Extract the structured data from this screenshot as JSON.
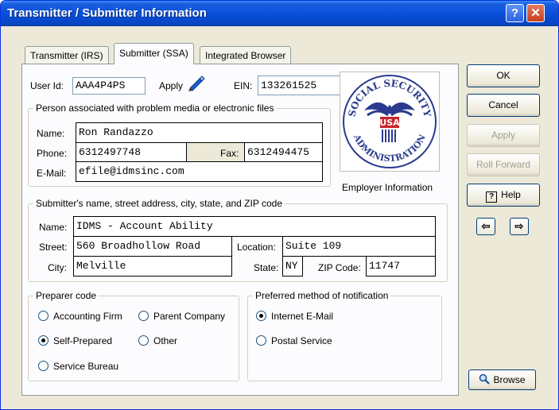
{
  "window": {
    "title": "Transmitter / Submitter Information",
    "help_glyph": "?",
    "close_glyph": "✕"
  },
  "tabs": [
    {
      "label": "Transmitter (IRS)"
    },
    {
      "label": "Submitter (SSA)"
    },
    {
      "label": "Integrated Browser"
    }
  ],
  "ids": {
    "user_id_label": "User Id:",
    "user_id_value": "AAA4P4PS",
    "apply_label": "Apply",
    "ein_label": "EIN:",
    "ein_value": "133261525"
  },
  "person_group": {
    "legend": "Person associated with problem media or electronic files",
    "name_label": "Name:",
    "name_value": "Ron Randazzo",
    "phone_label": "Phone:",
    "phone_value": "6312497748",
    "fax_label": "Fax:",
    "fax_value": "6312494475",
    "email_label": "E-Mail:",
    "email_value": "efile@idmsinc.com"
  },
  "seal": {
    "top_text": "SOCIAL SECURITY",
    "bottom_text": "ADMINISTRATION",
    "center_text": "USA",
    "caption": "Employer Information"
  },
  "address_group": {
    "legend": "Submitter's name, street address, city, state, and ZIP code",
    "name_label": "Name:",
    "name_value": "IDMS - Account Ability",
    "street_label": "Street:",
    "street_value": "560 Broadhollow Road",
    "location_label": "Location:",
    "location_value": "Suite 109",
    "city_label": "City:",
    "city_value": "Melville",
    "state_label": "State:",
    "state_value": "NY",
    "zip_label": "ZIP Code:",
    "zip_value": "11747"
  },
  "preparer_group": {
    "legend": "Preparer code",
    "options": [
      {
        "label": "Accounting Firm",
        "selected": false
      },
      {
        "label": "Parent Company",
        "selected": false
      },
      {
        "label": "Self-Prepared",
        "selected": true
      },
      {
        "label": "Other",
        "selected": false
      },
      {
        "label": "Service Bureau",
        "selected": false
      }
    ]
  },
  "notify_group": {
    "legend": "Preferred method of notification",
    "options": [
      {
        "label": "Internet E-Mail",
        "selected": true
      },
      {
        "label": "Postal Service",
        "selected": false
      }
    ]
  },
  "buttons": {
    "ok": "OK",
    "cancel": "Cancel",
    "apply": "Apply",
    "roll_forward": "Roll Forward",
    "help": "Help",
    "help_glyph": "?",
    "prev_glyph": "⇦",
    "next_glyph": "⇨",
    "browse": "Browse"
  }
}
